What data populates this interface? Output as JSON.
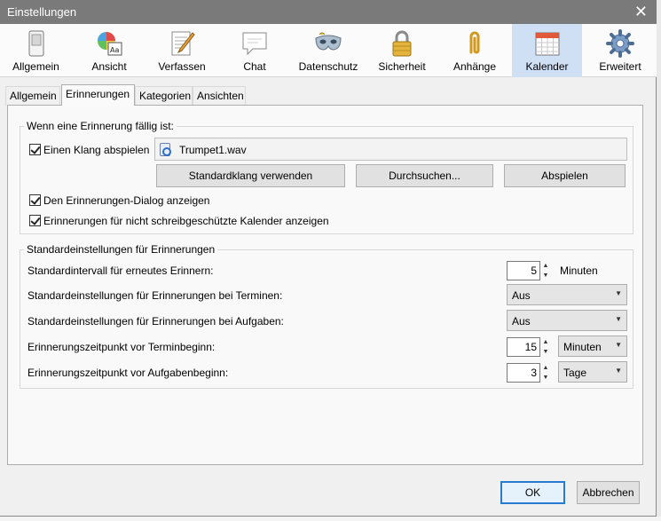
{
  "window": {
    "title": "Einstellungen",
    "close_glyph": "✕"
  },
  "toolbar": {
    "items": [
      {
        "label": "Allgemein",
        "icon": "switch-icon"
      },
      {
        "label": "Ansicht",
        "icon": "palette-icon"
      },
      {
        "label": "Verfassen",
        "icon": "compose-icon"
      },
      {
        "label": "Chat",
        "icon": "chat-bubble-icon"
      },
      {
        "label": "Datenschutz",
        "icon": "mask-icon"
      },
      {
        "label": "Sicherheit",
        "icon": "padlock-icon"
      },
      {
        "label": "Anhänge",
        "icon": "paperclip-icon"
      },
      {
        "label": "Kalender",
        "icon": "calendar-icon",
        "selected": true
      },
      {
        "label": "Erweitert",
        "icon": "gear-icon"
      }
    ]
  },
  "subtabs": [
    "Allgemein",
    "Erinnerungen",
    "Kategorien",
    "Ansichten"
  ],
  "active_subtab": "Erinnerungen",
  "due_group": {
    "legend": "Wenn eine Erinnerung fällig ist:",
    "play_sound": {
      "label": "Einen Klang abspielen",
      "checked": true
    },
    "sound_file": "Trumpet1.wav",
    "buttons": {
      "default_sound": "Standardklang verwenden",
      "browse": "Durchsuchen...",
      "play": "Abspielen"
    },
    "show_dialog": {
      "label": "Den Erinnerungen-Dialog anzeigen",
      "checked": true
    },
    "readonly_calendars": {
      "label": "Erinnerungen für nicht schreibgeschützte Kalender anzeigen",
      "checked": true
    }
  },
  "defaults_group": {
    "legend": "Standardeinstellungen für Erinnerungen",
    "snooze": {
      "label": "Standardintervall für erneutes Erinnern:",
      "value": "5",
      "unit": "Minuten"
    },
    "event_default": {
      "label": "Standardeinstellungen für Erinnerungen bei Terminen:",
      "value": "Aus"
    },
    "task_default": {
      "label": "Standardeinstellungen für Erinnerungen bei Aufgaben:",
      "value": "Aus"
    },
    "event_offset": {
      "label": "Erinnerungszeitpunkt vor Terminbeginn:",
      "value": "15",
      "unit": "Minuten"
    },
    "task_offset": {
      "label": "Erinnerungszeitpunkt vor Aufgabenbeginn:",
      "value": "3",
      "unit": "Tage"
    }
  },
  "footer": {
    "ok": "OK",
    "cancel": "Abbrechen"
  }
}
